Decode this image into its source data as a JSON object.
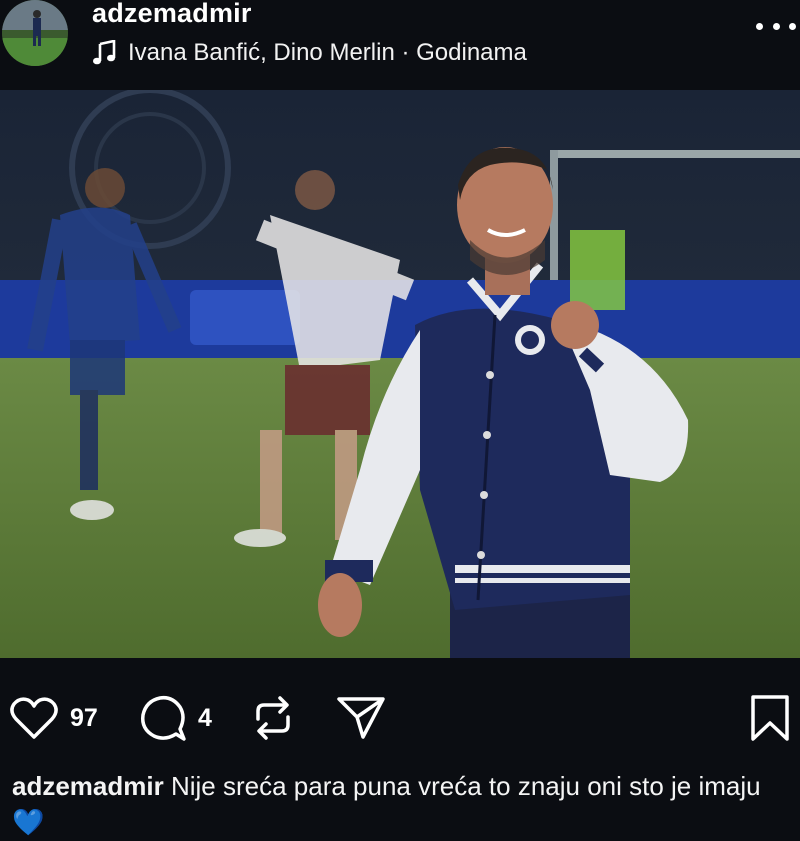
{
  "post": {
    "username": "adzemadmir",
    "music": "Ivana Banfić, Dino Merlin · Godinama"
  },
  "icons": {
    "music": "music-note-icon",
    "more": "more-options-icon",
    "sound": "speaker-icon",
    "like": "heart-icon",
    "comment": "comment-icon",
    "repost": "repost-icon",
    "share": "send-icon",
    "save": "bookmark-icon"
  },
  "actions": {
    "likes": "97",
    "comments": "4"
  },
  "caption": {
    "username": "adzemadmir",
    "text": "Nije sreća para puna vreća to znaju oni sto je imaju",
    "emoji": "💙"
  },
  "colors": {
    "background": "#0b0d12",
    "jacket_navy": "#1e2a5c",
    "pitch_green": "#5f7d3a"
  }
}
